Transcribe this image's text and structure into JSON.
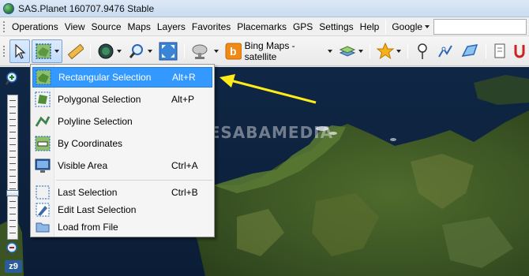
{
  "window": {
    "title": "SAS.Planet 160707.9476 Stable"
  },
  "menubar": {
    "items": [
      "Operations",
      "View",
      "Source",
      "Maps",
      "Layers",
      "Favorites",
      "Placemarks",
      "GPS",
      "Settings",
      "Help"
    ],
    "search_provider": "Google",
    "search_value": ""
  },
  "toolbar": {
    "map_source_label": "Bing Maps - satellite"
  },
  "map": {
    "watermark": "NESABAMEDIA",
    "zoom_level_label": "z9",
    "zoom_level_fraction": 0.69
  },
  "selection_menu": {
    "items": [
      {
        "label": "Rectangular Selection",
        "shortcut": "Alt+R",
        "icon": "rectangle-selection-icon",
        "highlighted": true
      },
      {
        "label": "Polygonal Selection",
        "shortcut": "Alt+P",
        "icon": "polygon-selection-icon"
      },
      {
        "label": "Polyline Selection",
        "shortcut": "",
        "icon": "polyline-selection-icon"
      },
      {
        "label": "By Coordinates",
        "shortcut": "",
        "icon": "coordinates-icon"
      },
      {
        "label": "Visible Area",
        "shortcut": "Ctrl+A",
        "icon": "visible-area-icon"
      },
      {
        "label": "Last Selection",
        "shortcut": "Ctrl+B",
        "icon": "last-selection-icon"
      },
      {
        "label": "Edit Last Selection",
        "shortcut": "",
        "icon": "edit-selection-icon"
      },
      {
        "label": "Load from File",
        "shortcut": "",
        "icon": "folder-icon"
      }
    ]
  },
  "colors": {
    "highlight": "#3399ff",
    "annotation_arrow": "#ffeb1a"
  }
}
